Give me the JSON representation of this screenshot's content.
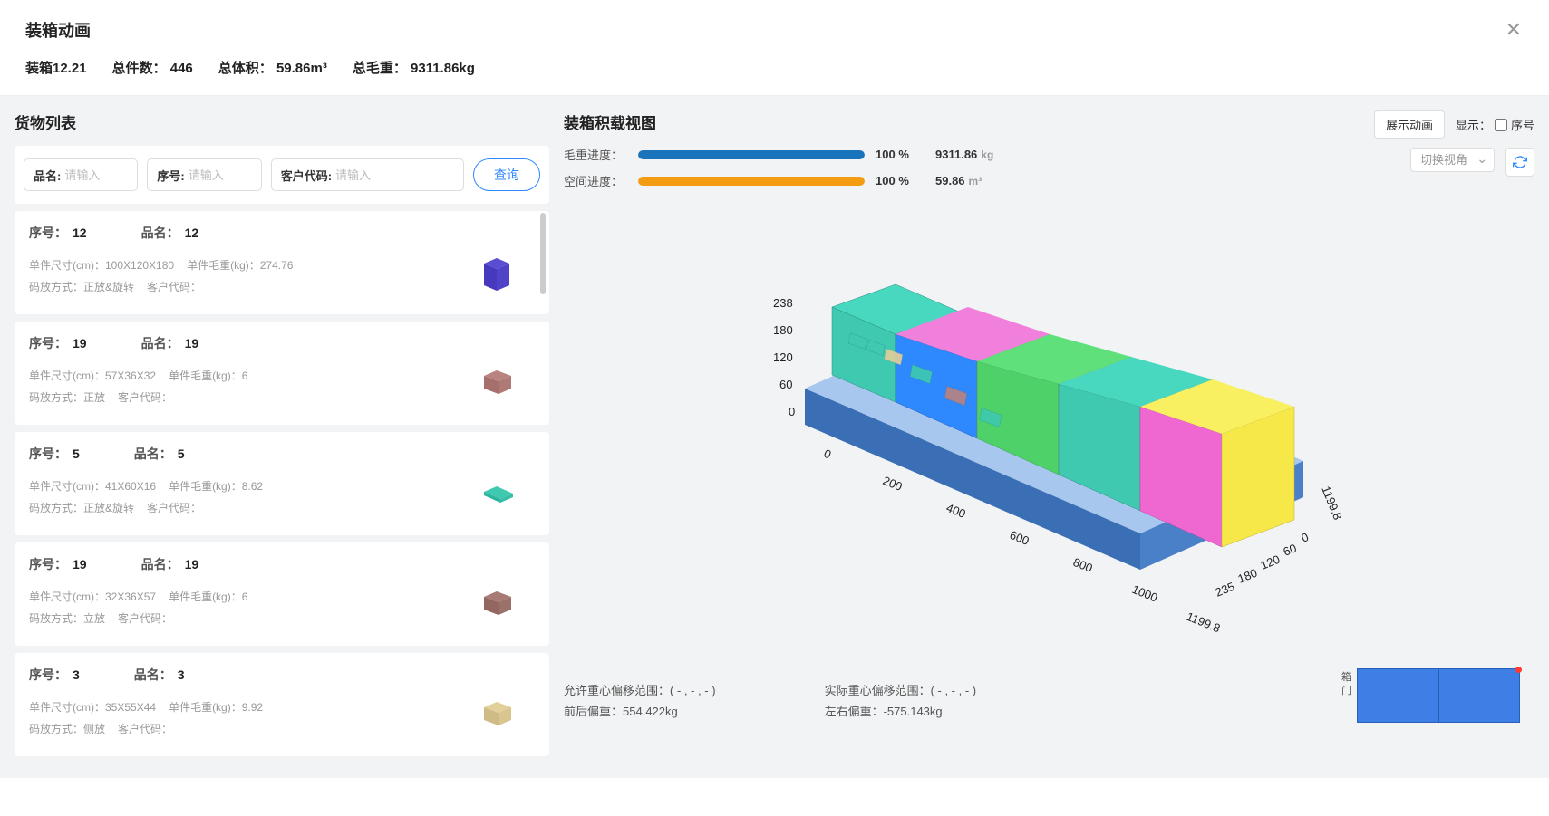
{
  "header": {
    "title": "装箱动画"
  },
  "summary": {
    "container_label": "装箱12.21",
    "pieces_label": "总件数：",
    "pieces_value": "446",
    "volume_label": "总体积：",
    "volume_value": "59.86m³",
    "weight_label": "总毛重：",
    "weight_value": "9311.86kg"
  },
  "left": {
    "title": "货物列表",
    "filters": {
      "name_label": "品名:",
      "seq_label": "序号:",
      "cust_label": "客户代码:",
      "placeholder": "请输入",
      "query_btn": "查询"
    },
    "labels": {
      "seq": "序号：",
      "name": "品名：",
      "size": "单件尺寸(cm)：",
      "weight": "单件毛重(kg)：",
      "stow": "码放方式：",
      "cust": "客户代码："
    },
    "items": [
      {
        "seq": "12",
        "name": "12",
        "size": "100X120X180",
        "weight": "274.76",
        "stow": "正放&旋转",
        "cust": "",
        "color": "#5b4dd1",
        "shape": "tall"
      },
      {
        "seq": "19",
        "name": "19",
        "size": "57X36X32",
        "weight": "6",
        "stow": "正放",
        "cust": "",
        "color": "#b9837f",
        "shape": "med"
      },
      {
        "seq": "5",
        "name": "5",
        "size": "41X60X16",
        "weight": "8.62",
        "stow": "正放&旋转",
        "cust": "",
        "color": "#3ec9b0",
        "shape": "flat"
      },
      {
        "seq": "19",
        "name": "19",
        "size": "32X36X57",
        "weight": "6",
        "stow": "立放",
        "cust": "",
        "color": "#a67b74",
        "shape": "med"
      },
      {
        "seq": "3",
        "name": "3",
        "size": "35X55X44",
        "weight": "9.92",
        "stow": "侧放",
        "cust": "",
        "color": "#e3cf9a",
        "shape": "med"
      }
    ]
  },
  "right": {
    "title": "装箱积载视图",
    "controls": {
      "anim_btn": "展示动画",
      "show_label": "显示：",
      "seq_checkbox": "序号",
      "view_select": "切换视角"
    },
    "progress": {
      "weight_label": "毛重进度：",
      "weight_pct": "100",
      "weight_val": "9311.86",
      "weight_unit": "kg",
      "space_label": "空间进度：",
      "space_pct": "100",
      "space_val": "59.86",
      "space_unit": "m³",
      "pct_suffix": "%"
    },
    "bottom": {
      "allow_range_label": "允许重心偏移范围：",
      "allow_range_val": "( - , - , - )",
      "fb_label": "前后偏重：",
      "fb_val": "554.422kg",
      "actual_range_label": "实际重心偏移范围：",
      "actual_range_val": "( - , - , - )",
      "lr_label": "左右偏重：",
      "lr_val": "-575.143kg"
    },
    "minimap": {
      "label_box": "箱",
      "label_door": "门"
    },
    "axes": {
      "z_ticks": [
        "238",
        "180",
        "120",
        "60",
        "0"
      ],
      "x_ticks": [
        "0",
        "200",
        "400",
        "600",
        "800",
        "1000",
        "1199.8"
      ],
      "y_ticks": [
        "0",
        "60",
        "120",
        "180",
        "235",
        "1199.8"
      ]
    }
  }
}
